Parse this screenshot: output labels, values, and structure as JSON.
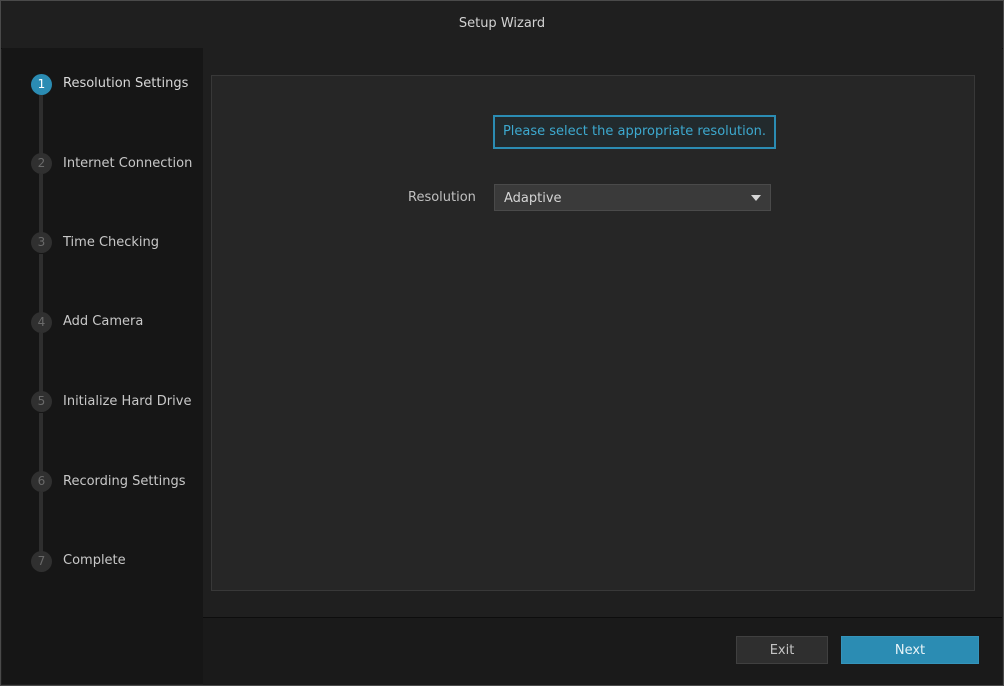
{
  "window": {
    "title": "Setup Wizard"
  },
  "steps": [
    {
      "number": "1",
      "label": "Resolution Settings",
      "active": true
    },
    {
      "number": "2",
      "label": "Internet Connection",
      "active": false
    },
    {
      "number": "3",
      "label": "Time Checking",
      "active": false
    },
    {
      "number": "4",
      "label": "Add Camera",
      "active": false
    },
    {
      "number": "5",
      "label": "Initialize Hard Drive",
      "active": false
    },
    {
      "number": "6",
      "label": "Recording Settings",
      "active": false
    },
    {
      "number": "7",
      "label": "Complete",
      "active": false
    }
  ],
  "content": {
    "hint": "Please select the appropriate resolution.",
    "resolution_label": "Resolution",
    "resolution_value": "Adaptive"
  },
  "footer": {
    "exit_label": "Exit",
    "next_label": "Next"
  },
  "colors": {
    "accent": "#2b8cb3",
    "background": "#1f1f1f"
  },
  "icons": {
    "dropdown": "chevron-down-icon"
  }
}
